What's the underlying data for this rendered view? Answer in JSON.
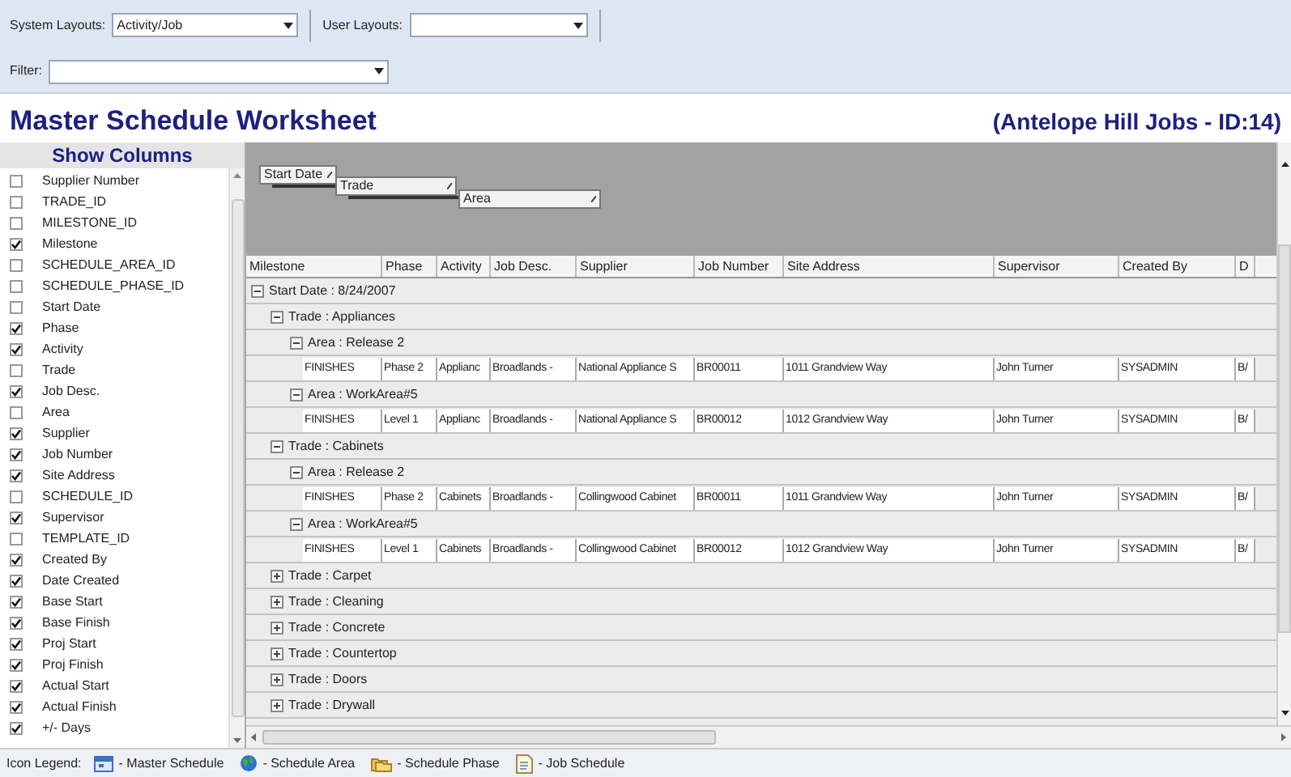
{
  "toolbar": {
    "system_layouts": {
      "label": "System Layouts:",
      "value": "Activity/Job"
    },
    "user_layouts": {
      "label": "User Layouts:"
    },
    "filter": {
      "label": "Filter:"
    }
  },
  "title": "Master Schedule Worksheet",
  "subtitle": "(Antelope Hill Jobs - ID:14)",
  "show_columns": {
    "title": "Show Columns",
    "items": [
      {
        "label": "Supplier Number",
        "checked": false
      },
      {
        "label": "TRADE_ID",
        "checked": false
      },
      {
        "label": "MILESTONE_ID",
        "checked": false
      },
      {
        "label": "Milestone",
        "checked": true
      },
      {
        "label": "SCHEDULE_AREA_ID",
        "checked": false
      },
      {
        "label": "SCHEDULE_PHASE_ID",
        "checked": false
      },
      {
        "label": "Start Date",
        "checked": false
      },
      {
        "label": "Phase",
        "checked": true
      },
      {
        "label": "Activity",
        "checked": true
      },
      {
        "label": "Trade",
        "checked": false
      },
      {
        "label": "Job Desc.",
        "checked": true
      },
      {
        "label": "Area",
        "checked": false
      },
      {
        "label": "Supplier",
        "checked": true
      },
      {
        "label": "Job Number",
        "checked": true
      },
      {
        "label": "Site Address",
        "checked": true
      },
      {
        "label": "SCHEDULE_ID",
        "checked": false
      },
      {
        "label": "Supervisor",
        "checked": true
      },
      {
        "label": "TEMPLATE_ID",
        "checked": false
      },
      {
        "label": "Created By",
        "checked": true
      },
      {
        "label": "Date Created",
        "checked": true
      },
      {
        "label": "Base Start",
        "checked": true
      },
      {
        "label": "Base Finish",
        "checked": true
      },
      {
        "label": "Proj Start",
        "checked": true
      },
      {
        "label": "Proj Finish",
        "checked": true
      },
      {
        "label": "Actual Start",
        "checked": true
      },
      {
        "label": "Actual Finish",
        "checked": true
      },
      {
        "label": "+/- Days",
        "checked": true
      }
    ]
  },
  "group_by": [
    "Start Date",
    "Trade",
    "Area"
  ],
  "grid": {
    "columns": [
      "Milestone",
      "Phase",
      "Activity",
      "Job Desc.",
      "Supplier",
      "Job Number",
      "Site Address",
      "Supervisor",
      "Created By",
      "D"
    ],
    "groups": [
      {
        "label": "Start Date : 8/24/2007",
        "expanded": true,
        "children": [
          {
            "label": "Trade : Appliances",
            "expanded": true,
            "children": [
              {
                "label": "Area : Release 2",
                "expanded": true,
                "rows": [
                  [
                    "FINISHES",
                    "Phase 2",
                    "Applianc",
                    "Broadlands -",
                    "National Appliance S",
                    "BR00011",
                    "1011 Grandview Way",
                    "John Turner",
                    "SYSADMIN",
                    "B/"
                  ]
                ]
              },
              {
                "label": "Area : WorkArea#5",
                "expanded": true,
                "rows": [
                  [
                    "FINISHES",
                    "Level 1",
                    "Applianc",
                    "Broadlands -",
                    "National Appliance S",
                    "BR00012",
                    "1012 Grandview Way",
                    "John Turner",
                    "SYSADMIN",
                    "B/"
                  ]
                ]
              }
            ]
          },
          {
            "label": "Trade : Cabinets",
            "expanded": true,
            "children": [
              {
                "label": "Area : Release 2",
                "expanded": true,
                "rows": [
                  [
                    "FINISHES",
                    "Phase 2",
                    "Cabinets",
                    "Broadlands -",
                    "Collingwood Cabinet",
                    "BR00011",
                    "1011 Grandview Way",
                    "John Turner",
                    "SYSADMIN",
                    "B/"
                  ]
                ]
              },
              {
                "label": "Area : WorkArea#5",
                "expanded": true,
                "rows": [
                  [
                    "FINISHES",
                    "Level 1",
                    "Cabinets",
                    "Broadlands -",
                    "Collingwood Cabinet",
                    "BR00012",
                    "1012 Grandview Way",
                    "John Turner",
                    "SYSADMIN",
                    "B/"
                  ]
                ]
              }
            ]
          },
          {
            "label": "Trade : Carpet",
            "expanded": false
          },
          {
            "label": "Trade : Cleaning",
            "expanded": false
          },
          {
            "label": "Trade : Concrete",
            "expanded": false
          },
          {
            "label": "Trade : Countertop",
            "expanded": false
          },
          {
            "label": "Trade : Doors",
            "expanded": false
          },
          {
            "label": "Trade : Drywall",
            "expanded": false
          }
        ]
      }
    ]
  },
  "legend": {
    "label": "Icon Legend:",
    "items": [
      {
        "kind": "master",
        "label": "- Master Schedule"
      },
      {
        "kind": "area",
        "label": "- Schedule Area"
      },
      {
        "kind": "phase",
        "label": "- Schedule Phase"
      },
      {
        "kind": "job",
        "label": "- Job Schedule"
      }
    ]
  }
}
